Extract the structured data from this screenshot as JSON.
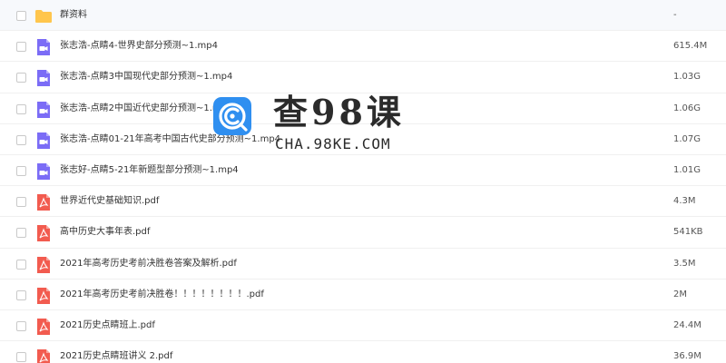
{
  "colors": {
    "folder": "#ffc54d",
    "video": "#7b6cf6",
    "pdf": "#f25b4f",
    "watermark_logo": "#2f8ff0"
  },
  "files": [
    {
      "icon": "folder-icon",
      "name": "群资料",
      "size": "-"
    },
    {
      "icon": "video-file-icon",
      "name": "张志浩-点睛4-世界史部分预测~1.mp4",
      "size": "615.4M"
    },
    {
      "icon": "video-file-icon",
      "name": "张志浩-点睛3中国现代史部分预测~1.mp4",
      "size": "1.03G"
    },
    {
      "icon": "video-file-icon",
      "name": "张志浩-点睛2中国近代史部分预测~1.mp4",
      "size": "1.06G"
    },
    {
      "icon": "video-file-icon",
      "name": "张志浩-点睛01-21年高考中国古代史部分预测~1.mp4",
      "size": "1.07G"
    },
    {
      "icon": "video-file-icon",
      "name": "张志好-点睛5-21年新题型部分预测~1.mp4",
      "size": "1.01G"
    },
    {
      "icon": "pdf-file-icon",
      "name": "世界近代史基础知识.pdf",
      "size": "4.3M"
    },
    {
      "icon": "pdf-file-icon",
      "name": "高中历史大事年表.pdf",
      "size": "541KB"
    },
    {
      "icon": "pdf-file-icon",
      "name": "2021年高考历史考前决胜卷答案及解析.pdf",
      "size": "3.5M"
    },
    {
      "icon": "pdf-file-icon",
      "name": "2021年高考历史考前决胜卷！！！！！！！！.pdf",
      "size": "2M"
    },
    {
      "icon": "pdf-file-icon",
      "name": "2021历史点睛班上.pdf",
      "size": "24.4M"
    },
    {
      "icon": "pdf-file-icon",
      "name": "2021历史点睛班讲义 2.pdf",
      "size": "36.9M"
    }
  ],
  "watermark": {
    "title": "查98课",
    "url": "CHA.98KE.COM"
  }
}
